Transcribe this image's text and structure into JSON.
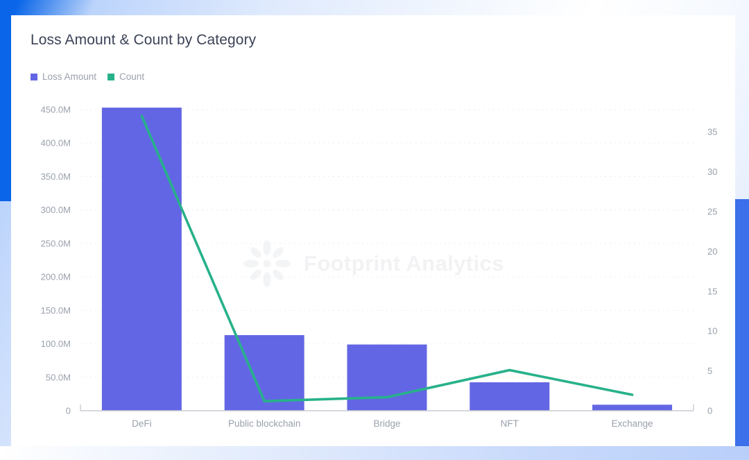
{
  "card": {
    "title": "Loss Amount & Count by Category",
    "watermark": "Footprint Analytics",
    "watermark_icon": "sunburst-logo-icon"
  },
  "legend": {
    "items": [
      {
        "label": "Loss Amount",
        "color": "#6366e4",
        "icon": "square-swatch-icon"
      },
      {
        "label": "Count",
        "color": "#27b18a",
        "icon": "square-swatch-icon"
      }
    ]
  },
  "chart_data": {
    "type": "bar",
    "title": "Loss Amount & Count by Category",
    "categories": [
      "DeFi",
      "Public blockchain",
      "Bridge",
      "NFT",
      "Exchange"
    ],
    "series": [
      {
        "name": "Loss Amount",
        "type": "bar",
        "axis": "left",
        "color": "#6366e4",
        "values": [
          453000000,
          113000000,
          99000000,
          42500000,
          9000000
        ]
      },
      {
        "name": "Count",
        "type": "line",
        "axis": "right",
        "color": "#27b18a",
        "values": [
          37,
          1.2,
          1.7,
          5.1,
          2.0
        ]
      }
    ],
    "xlabel": "",
    "ylabel": "",
    "grid": true,
    "legend_position": "top-left",
    "y_left": {
      "ylim": [
        0,
        450000000
      ],
      "ticks": [
        0,
        50000000,
        100000000,
        150000000,
        200000000,
        250000000,
        300000000,
        350000000,
        400000000,
        450000000
      ],
      "tick_labels": [
        "0",
        "50.0M",
        "100.0M",
        "150.0M",
        "200.0M",
        "250.0M",
        "300.0M",
        "350.0M",
        "400.0M",
        "450.0M"
      ]
    },
    "y_right": {
      "ylim": [
        0,
        35
      ],
      "ticks": [
        0,
        5,
        10,
        15,
        20,
        25,
        30,
        35
      ],
      "tick_labels": [
        "0",
        "5",
        "10",
        "15",
        "20",
        "25",
        "30",
        "35"
      ]
    }
  },
  "colors": {
    "bar": "#6366e4",
    "line": "#27b18a",
    "axis": "#c9ccd2",
    "grid": "#ededf0",
    "tick_text": "#9aa0ac",
    "title_text": "#3c4257",
    "background_accent": "#0a66e8"
  }
}
